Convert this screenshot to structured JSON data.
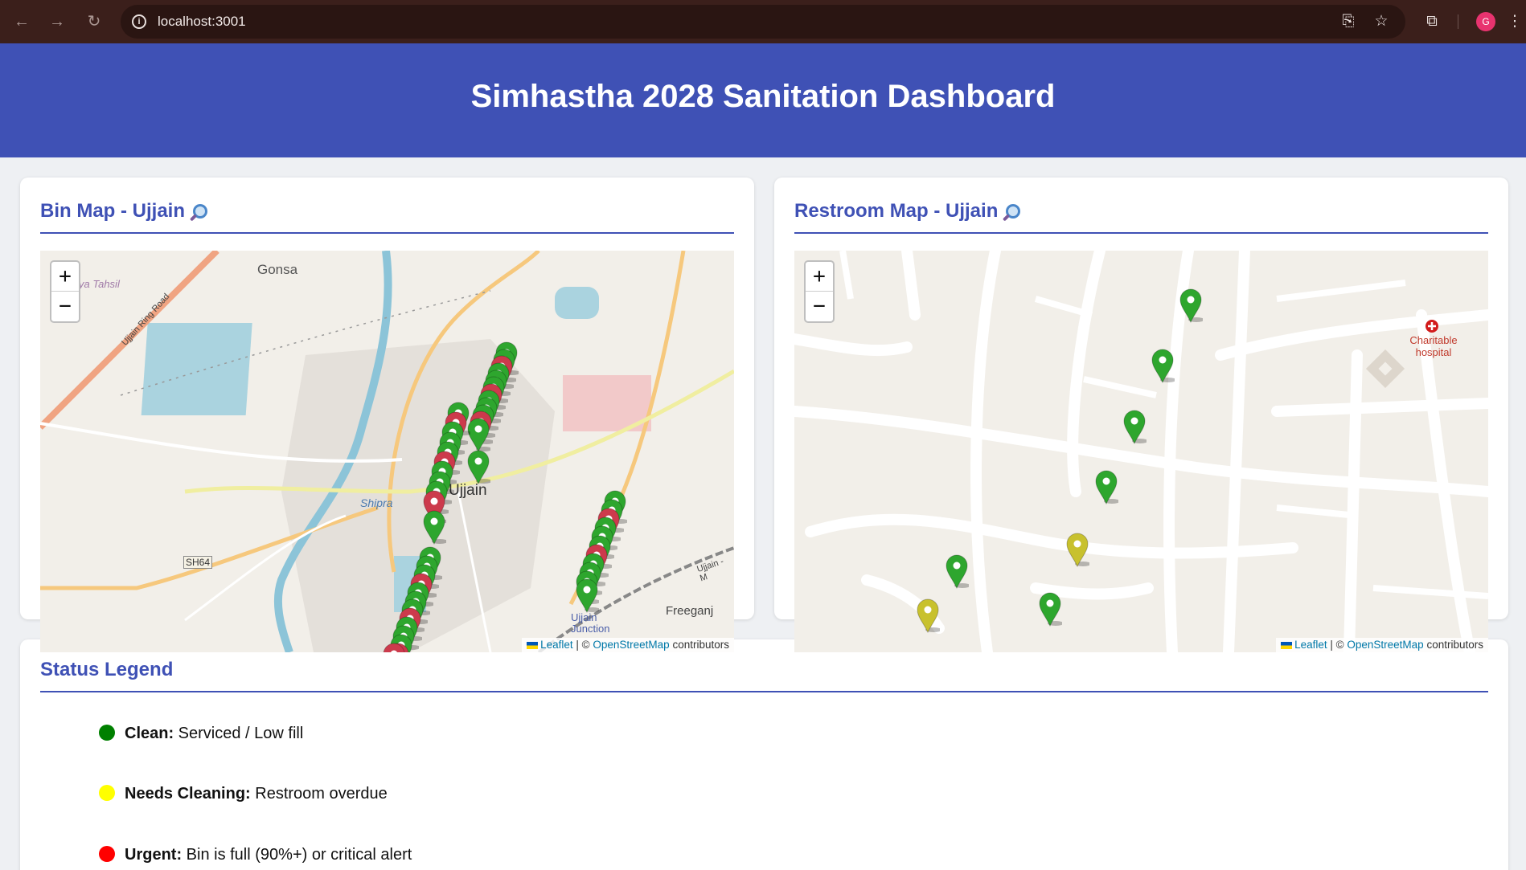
{
  "browser": {
    "url": "localhost:3001",
    "avatar_letter": "G"
  },
  "header": {
    "title": "Simhastha 2028 Sanitation Dashboard"
  },
  "bin_map": {
    "title": "Bin Map - Ujjain",
    "zoom_in": "+",
    "zoom_out": "−",
    "labels": {
      "gonsa": "Gonsa",
      "tahsil": "ya Tahsil",
      "ring_road": "Ujjain Ring Road",
      "city": "Ujjain",
      "river": "Shipra",
      "sh64": "SH64",
      "junction": "Ujjain Junction",
      "freeganj": "Freeganj",
      "ujjain_m": "Ujjain - M"
    },
    "attribution": {
      "leaflet": "Leaflet",
      "sep": " | © ",
      "osm": "OpenStreetMap",
      "contrib": " contributors"
    }
  },
  "restroom_map": {
    "title": "Restroom Map - Ujjain",
    "zoom_in": "+",
    "zoom_out": "−",
    "labels": {
      "hospital": "Charitable hospital"
    },
    "attribution": {
      "leaflet": "Leaflet",
      "sep": " | © ",
      "osm": "OpenStreetMap",
      "contrib": " contributors"
    }
  },
  "legend": {
    "title": "Status Legend",
    "items": [
      {
        "status": "Clean:",
        "desc": " Serviced / Low fill",
        "color": "#008000"
      },
      {
        "status": "Needs Cleaning:",
        "desc": " Restroom overdue",
        "color": "#ffff00"
      },
      {
        "status": "Urgent:",
        "desc": " Bin is full (90%+) or critical alert",
        "color": "#ff0000"
      }
    ]
  },
  "colors": {
    "accent": "#3f51b5",
    "clean_pin": "#2ea62e",
    "urgent_pin": "#cc3a4c",
    "warn_pin": "#c8c12e"
  }
}
